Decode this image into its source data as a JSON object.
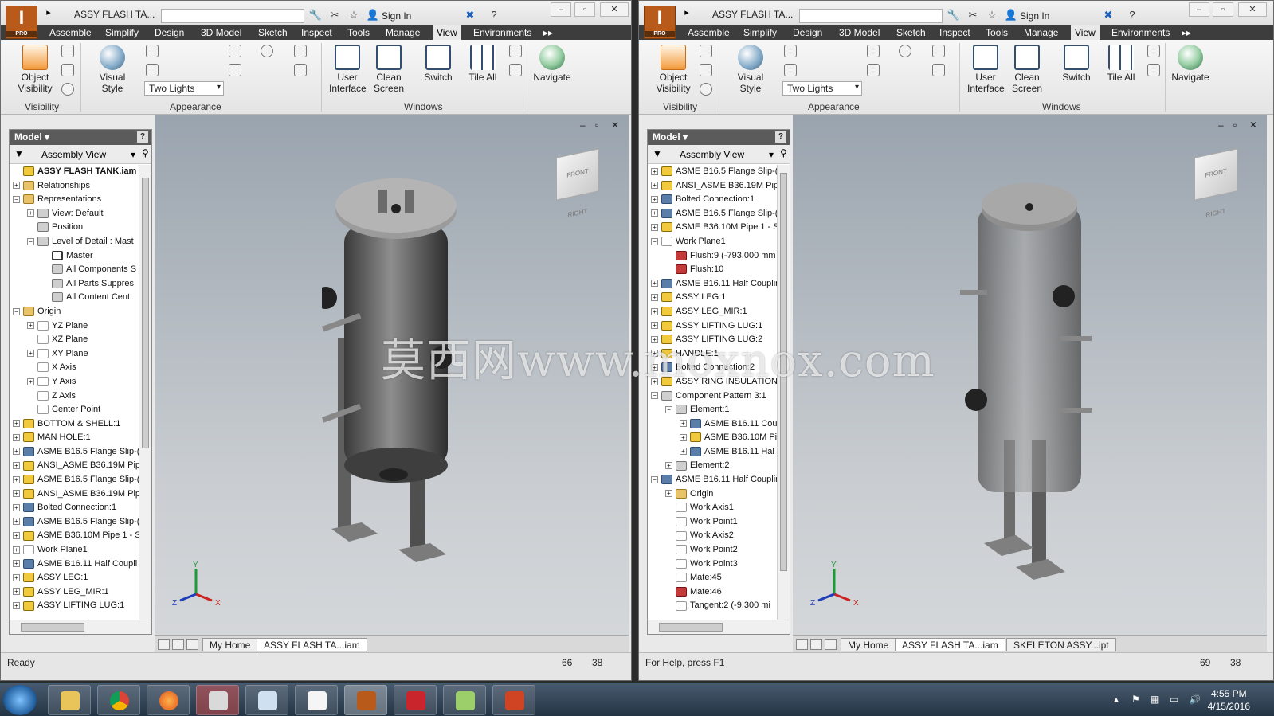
{
  "left": {
    "title": "ASSY FLASH TA...",
    "signin": "Sign In",
    "menus": [
      "Assemble",
      "Simplify",
      "Design",
      "3D Model",
      "Sketch",
      "Inspect",
      "Tools",
      "Manage",
      "View",
      "Environments"
    ],
    "active_menu": "View",
    "ribbon": {
      "object_visibility": "Object\nVisibility",
      "visual_style": "Visual Style",
      "two_lights": "Two Lights",
      "user_interface": "User\nInterface",
      "clean_screen": "Clean\nScreen",
      "switch": "Switch",
      "tile_all": "Tile All",
      "navigate": "Navigate",
      "group_visibility": "Visibility",
      "group_appearance": "Appearance",
      "group_windows": "Windows"
    },
    "browser_title": "Model",
    "assembly_view": "Assembly View",
    "tree": [
      {
        "t": "ASSY FLASH TANK.iam",
        "lvl": 0,
        "pm": "",
        "ic": "asm",
        "bold": true
      },
      {
        "t": "Relationships",
        "lvl": 0,
        "pm": "+",
        "ic": "folder"
      },
      {
        "t": "Representations",
        "lvl": 0,
        "pm": "-",
        "ic": "folder"
      },
      {
        "t": "View: Default",
        "lvl": 1,
        "pm": "+",
        "ic": "doc"
      },
      {
        "t": "Position",
        "lvl": 1,
        "pm": "",
        "ic": "doc"
      },
      {
        "t": "Level of Detail : Mast",
        "lvl": 1,
        "pm": "-",
        "ic": "doc"
      },
      {
        "t": "Master",
        "lvl": 2,
        "pm": "",
        "ic": "chk"
      },
      {
        "t": "All Components S",
        "lvl": 2,
        "pm": "",
        "ic": "doc"
      },
      {
        "t": "All Parts Suppres",
        "lvl": 2,
        "pm": "",
        "ic": "doc"
      },
      {
        "t": "All Content Cent",
        "lvl": 2,
        "pm": "",
        "ic": "doc"
      },
      {
        "t": "Origin",
        "lvl": 0,
        "pm": "-",
        "ic": "folder"
      },
      {
        "t": "YZ Plane",
        "lvl": 1,
        "pm": "+",
        "ic": "plane"
      },
      {
        "t": "XZ Plane",
        "lvl": 1,
        "pm": "",
        "ic": "plane"
      },
      {
        "t": "XY Plane",
        "lvl": 1,
        "pm": "+",
        "ic": "plane"
      },
      {
        "t": "X Axis",
        "lvl": 1,
        "pm": "",
        "ic": "plane"
      },
      {
        "t": "Y Axis",
        "lvl": 1,
        "pm": "+",
        "ic": "plane"
      },
      {
        "t": "Z Axis",
        "lvl": 1,
        "pm": "",
        "ic": "plane"
      },
      {
        "t": "Center Point",
        "lvl": 1,
        "pm": "",
        "ic": "plane"
      },
      {
        "t": "BOTTOM & SHELL:1",
        "lvl": 0,
        "pm": "+",
        "ic": "asm"
      },
      {
        "t": "MAN HOLE:1",
        "lvl": 0,
        "pm": "+",
        "ic": "asm"
      },
      {
        "t": "ASME B16.5 Flange Slip-(",
        "lvl": 0,
        "pm": "+",
        "ic": "part"
      },
      {
        "t": "ANSI_ASME B36.19M Pip",
        "lvl": 0,
        "pm": "+",
        "ic": "asm"
      },
      {
        "t": "ASME B16.5 Flange Slip-(",
        "lvl": 0,
        "pm": "+",
        "ic": "asm"
      },
      {
        "t": "ANSI_ASME B36.19M Pip",
        "lvl": 0,
        "pm": "+",
        "ic": "asm"
      },
      {
        "t": "Bolted Connection:1",
        "lvl": 0,
        "pm": "+",
        "ic": "part"
      },
      {
        "t": "ASME B16.5 Flange Slip-(",
        "lvl": 0,
        "pm": "+",
        "ic": "part"
      },
      {
        "t": "ASME B36.10M Pipe 1 - S",
        "lvl": 0,
        "pm": "+",
        "ic": "asm"
      },
      {
        "t": "Work Plane1",
        "lvl": 0,
        "pm": "+",
        "ic": "plane"
      },
      {
        "t": "ASME B16.11 Half Coupli",
        "lvl": 0,
        "pm": "+",
        "ic": "part"
      },
      {
        "t": "ASSY LEG:1",
        "lvl": 0,
        "pm": "+",
        "ic": "asm"
      },
      {
        "t": "ASSY LEG_MIR:1",
        "lvl": 0,
        "pm": "+",
        "ic": "asm"
      },
      {
        "t": "ASSY LIFTING LUG:1",
        "lvl": 0,
        "pm": "+",
        "ic": "asm"
      }
    ],
    "tabs": [
      "My Home",
      "ASSY FLASH TA...iam"
    ],
    "status": "Ready",
    "n1": "66",
    "n2": "38"
  },
  "right": {
    "title": "ASSY FLASH TA...",
    "signin": "Sign In",
    "browser_title": "Model",
    "assembly_view": "Assembly View",
    "tree": [
      {
        "t": "ASME B16.5 Flange Slip-(",
        "lvl": 0,
        "pm": "+",
        "ic": "asm"
      },
      {
        "t": "ANSI_ASME B36.19M Pip",
        "lvl": 0,
        "pm": "+",
        "ic": "asm"
      },
      {
        "t": "Bolted Connection:1",
        "lvl": 0,
        "pm": "+",
        "ic": "part"
      },
      {
        "t": "ASME B16.5 Flange Slip-(",
        "lvl": 0,
        "pm": "+",
        "ic": "part"
      },
      {
        "t": "ASME B36.10M Pipe 1 - S",
        "lvl": 0,
        "pm": "+",
        "ic": "asm"
      },
      {
        "t": "Work Plane1",
        "lvl": 0,
        "pm": "-",
        "ic": "plane"
      },
      {
        "t": "Flush:9 (-793.000 mm",
        "lvl": 1,
        "pm": "",
        "ic": "red"
      },
      {
        "t": "Flush:10",
        "lvl": 1,
        "pm": "",
        "ic": "red"
      },
      {
        "t": "ASME B16.11 Half Couplir",
        "lvl": 0,
        "pm": "+",
        "ic": "part"
      },
      {
        "t": "ASSY LEG:1",
        "lvl": 0,
        "pm": "+",
        "ic": "asm"
      },
      {
        "t": "ASSY LEG_MIR:1",
        "lvl": 0,
        "pm": "+",
        "ic": "asm"
      },
      {
        "t": "ASSY LIFTING LUG:1",
        "lvl": 0,
        "pm": "+",
        "ic": "asm"
      },
      {
        "t": "ASSY LIFTING LUG:2",
        "lvl": 0,
        "pm": "+",
        "ic": "asm"
      },
      {
        "t": "HANDLE:1",
        "lvl": 0,
        "pm": "+",
        "ic": "asm"
      },
      {
        "t": "Bolted Connection:2",
        "lvl": 0,
        "pm": "+",
        "ic": "part"
      },
      {
        "t": "ASSY RING INSULATION:",
        "lvl": 0,
        "pm": "+",
        "ic": "asm"
      },
      {
        "t": "Component Pattern 3:1",
        "lvl": 0,
        "pm": "-",
        "ic": "doc"
      },
      {
        "t": "Element:1",
        "lvl": 1,
        "pm": "-",
        "ic": "doc"
      },
      {
        "t": "ASME B16.11 Cou",
        "lvl": 2,
        "pm": "+",
        "ic": "part"
      },
      {
        "t": "ASME B36.10M Pi",
        "lvl": 2,
        "pm": "+",
        "ic": "asm"
      },
      {
        "t": "ASME B16.11 Hal",
        "lvl": 2,
        "pm": "+",
        "ic": "part"
      },
      {
        "t": "Element:2",
        "lvl": 1,
        "pm": "+",
        "ic": "doc"
      },
      {
        "t": "ASME B16.11 Half Couplir",
        "lvl": 0,
        "pm": "-",
        "ic": "part"
      },
      {
        "t": "Origin",
        "lvl": 1,
        "pm": "+",
        "ic": "folder"
      },
      {
        "t": "Work Axis1",
        "lvl": 1,
        "pm": "",
        "ic": "plane"
      },
      {
        "t": "Work Point1",
        "lvl": 1,
        "pm": "",
        "ic": "plane"
      },
      {
        "t": "Work Axis2",
        "lvl": 1,
        "pm": "",
        "ic": "plane"
      },
      {
        "t": "Work Point2",
        "lvl": 1,
        "pm": "",
        "ic": "plane"
      },
      {
        "t": "Work Point3",
        "lvl": 1,
        "pm": "",
        "ic": "plane"
      },
      {
        "t": "Mate:45",
        "lvl": 1,
        "pm": "",
        "ic": "plane"
      },
      {
        "t": "Mate:46",
        "lvl": 1,
        "pm": "",
        "ic": "red"
      },
      {
        "t": "Tangent:2 (-9.300 mi",
        "lvl": 1,
        "pm": "",
        "ic": "plane"
      }
    ],
    "tabs": [
      "My Home",
      "ASSY FLASH TA...iam",
      "SKELETON ASSY...ipt"
    ],
    "status": "For Help, press F1",
    "n1": "69",
    "n2": "38"
  },
  "watermark": "莫西网www.moxnox.com",
  "clock": {
    "time": "4:55 PM",
    "date": "4/15/2016"
  },
  "axis_labels": {
    "x": "X",
    "y": "Y",
    "z": "Z"
  }
}
